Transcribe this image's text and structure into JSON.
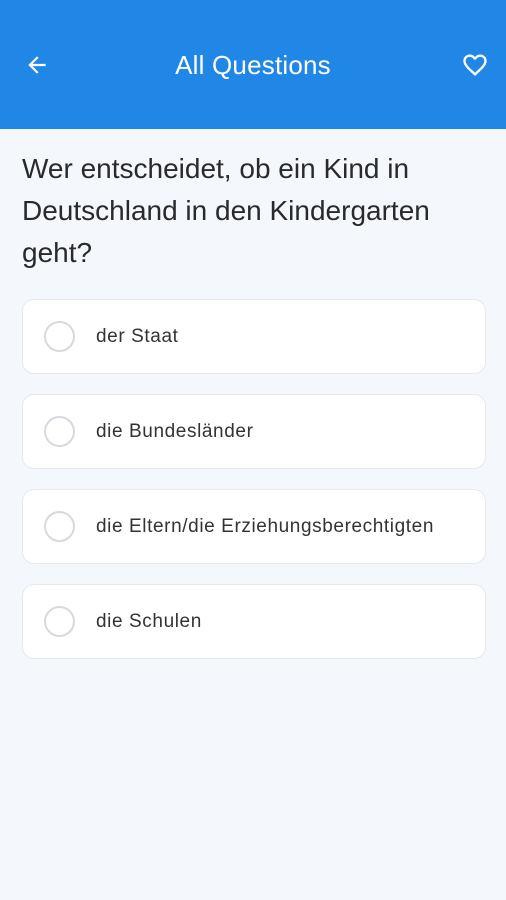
{
  "header": {
    "title": "All Questions",
    "back_icon": "arrow-left-icon",
    "favorite_icon": "heart-outline-icon",
    "color": "#2187e6"
  },
  "question": {
    "text": "Wer entscheidet, ob ein Kind in Deutschland in den Kindergarten geht?"
  },
  "options": [
    {
      "label": "der Staat"
    },
    {
      "label": "die Bundesländer"
    },
    {
      "label": "die Eltern/die Erziehungsberechtigten"
    },
    {
      "label": "die Schulen"
    }
  ]
}
